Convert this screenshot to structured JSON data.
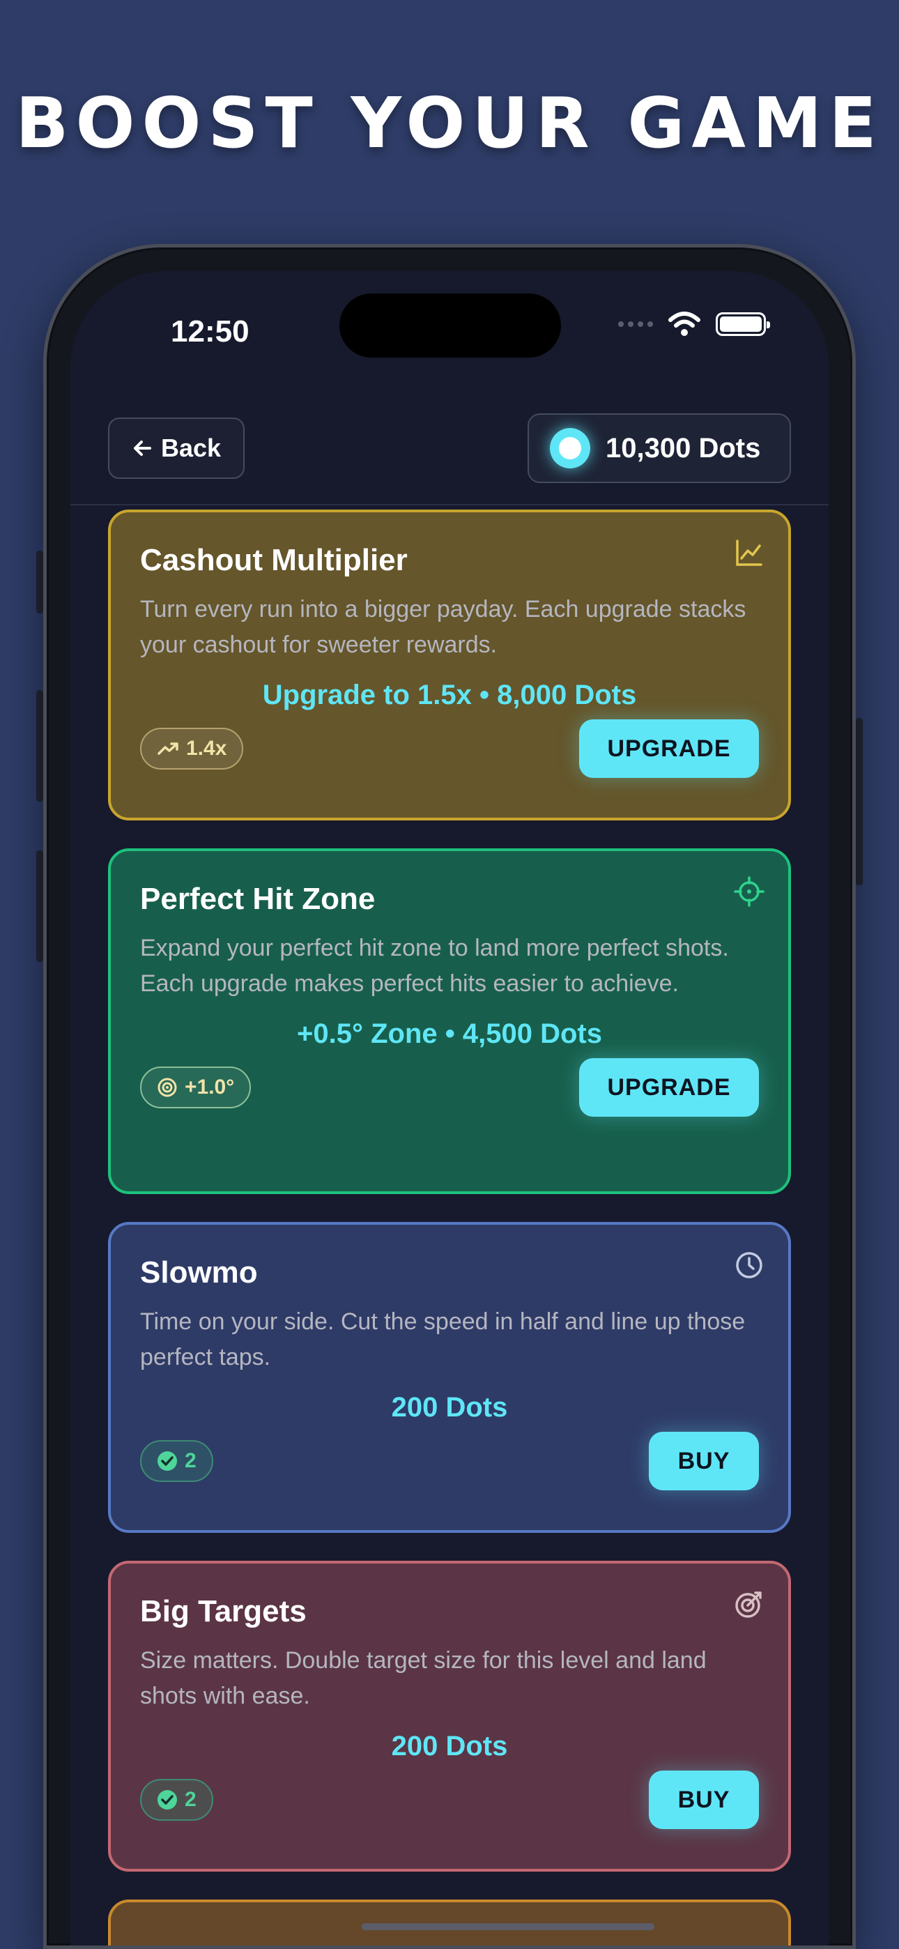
{
  "headline": "BOOST YOUR GAME",
  "status": {
    "time": "12:50"
  },
  "header": {
    "back_label": "Back",
    "balance": "10,300 Dots"
  },
  "accent_colors": {
    "cyan": "#5fe6f6",
    "gold": "#c9a52d",
    "green": "#1ec17d",
    "blue": "#5779c5",
    "red": "#c46872"
  },
  "cards": [
    {
      "title": "Cashout Multiplier",
      "description": "Turn every run into a bigger payday. Each upgrade stacks your cashout for sweeter rewards.",
      "price": "Upgrade to 1.5x • 8,000 Dots",
      "badge": "1.4x",
      "badge_icon": "trending-up-icon",
      "button": "UPGRADE",
      "corner_icon": "line-chart-icon"
    },
    {
      "title": "Perfect Hit Zone",
      "description": "Expand your perfect hit zone to land more perfect shots. Each upgrade makes perfect hits easier to achieve.",
      "price": "+0.5° Zone • 4,500 Dots",
      "badge": "+1.0°",
      "badge_icon": "target-icon",
      "button": "UPGRADE",
      "corner_icon": "crosshair-icon"
    },
    {
      "title": "Slowmo",
      "description": "Time on your side. Cut the speed in half and line up those perfect taps.",
      "price": "200 Dots",
      "badge": "2",
      "badge_icon": "check-circle-icon",
      "button": "BUY",
      "corner_icon": "clock-icon"
    },
    {
      "title": "Big Targets",
      "description": "Size matters. Double target size for this level and land shots with ease.",
      "price": "200 Dots",
      "badge": "2",
      "badge_icon": "check-circle-icon",
      "button": "BUY",
      "corner_icon": "target-arrow-icon"
    }
  ]
}
